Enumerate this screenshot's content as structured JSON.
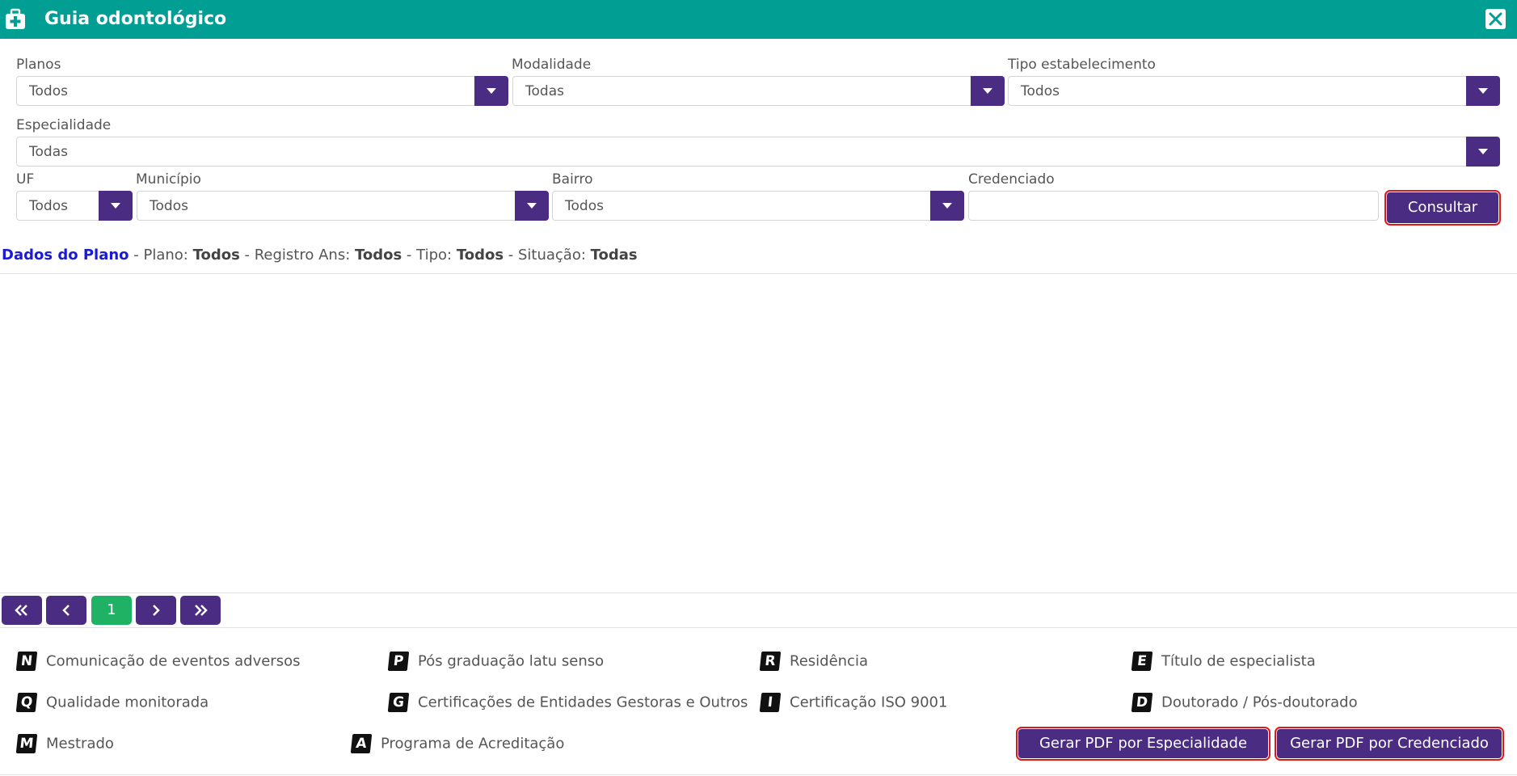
{
  "header": {
    "title": "Guia odontológico"
  },
  "filters": {
    "planos": {
      "label": "Planos",
      "value": "Todos"
    },
    "modalidade": {
      "label": "Modalidade",
      "value": "Todas"
    },
    "tipo_estabelecimento": {
      "label": "Tipo estabelecimento",
      "value": "Todos"
    },
    "especialidade": {
      "label": "Especialidade",
      "value": "Todas"
    },
    "uf": {
      "label": "UF",
      "value": "Todos"
    },
    "municipio": {
      "label": "Município",
      "value": "Todos"
    },
    "bairro": {
      "label": "Bairro",
      "value": "Todos"
    },
    "credenciado": {
      "label": "Credenciado",
      "value": "",
      "placeholder": ""
    },
    "consultar_label": "Consultar"
  },
  "plan_info": {
    "link": "Dados do Plano",
    "plano_label": " - Plano: ",
    "plano_value": "Todos",
    "registro_label": " - Registro Ans: ",
    "registro_value": "Todos",
    "tipo_label": " - Tipo: ",
    "tipo_value": "Todos",
    "situacao_label": " - Situação: ",
    "situacao_value": "Todas"
  },
  "pagination": {
    "current_page": "1"
  },
  "legend": [
    {
      "letter": "N",
      "text": "Comunicação de eventos adversos"
    },
    {
      "letter": "P",
      "text": "Pós graduação latu senso"
    },
    {
      "letter": "R",
      "text": "Residência"
    },
    {
      "letter": "E",
      "text": "Título de especialista"
    },
    {
      "letter": "Q",
      "text": "Qualidade monitorada"
    },
    {
      "letter": "G",
      "text": "Certificações de Entidades Gestoras e Outros"
    },
    {
      "letter": "I",
      "text": "Certificação ISO 9001"
    },
    {
      "letter": "D",
      "text": "Doutorado / Pós-doutorado"
    },
    {
      "letter": "M",
      "text": "Mestrado"
    },
    {
      "letter": "A",
      "text": "Programa de Acreditação"
    }
  ],
  "actions": {
    "pdf_especialidade": "Gerar PDF por Especialidade",
    "pdf_credenciado": "Gerar PDF por Credenciado"
  },
  "colors": {
    "header_bg": "#009e93",
    "primary": "#4a2c82",
    "current_page": "#1fb264",
    "link": "#1b1bd6",
    "highlight": "#e01818"
  }
}
